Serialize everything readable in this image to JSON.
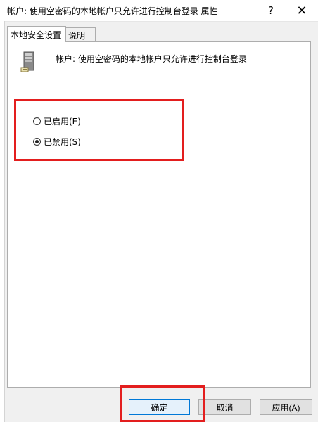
{
  "window": {
    "title": "帐户: 使用空密码的本地帐户只允许进行控制台登录 属性",
    "help_glyph": "?",
    "close_glyph": "✕"
  },
  "tabs": [
    {
      "label": "本地安全设置",
      "active": true
    },
    {
      "label": "说明",
      "active": false
    }
  ],
  "policy": {
    "icon": "server-icon",
    "title": "帐户: 使用空密码的本地帐户只允许进行控制台登录"
  },
  "options": [
    {
      "label": "已启用(E)",
      "selected": false
    },
    {
      "label": "已禁用(S)",
      "selected": true
    }
  ],
  "buttons": {
    "ok": "确定",
    "cancel": "取消",
    "apply": "应用(A)"
  },
  "colors": {
    "highlight": "#e31e1e",
    "focus": "#0078d7"
  }
}
